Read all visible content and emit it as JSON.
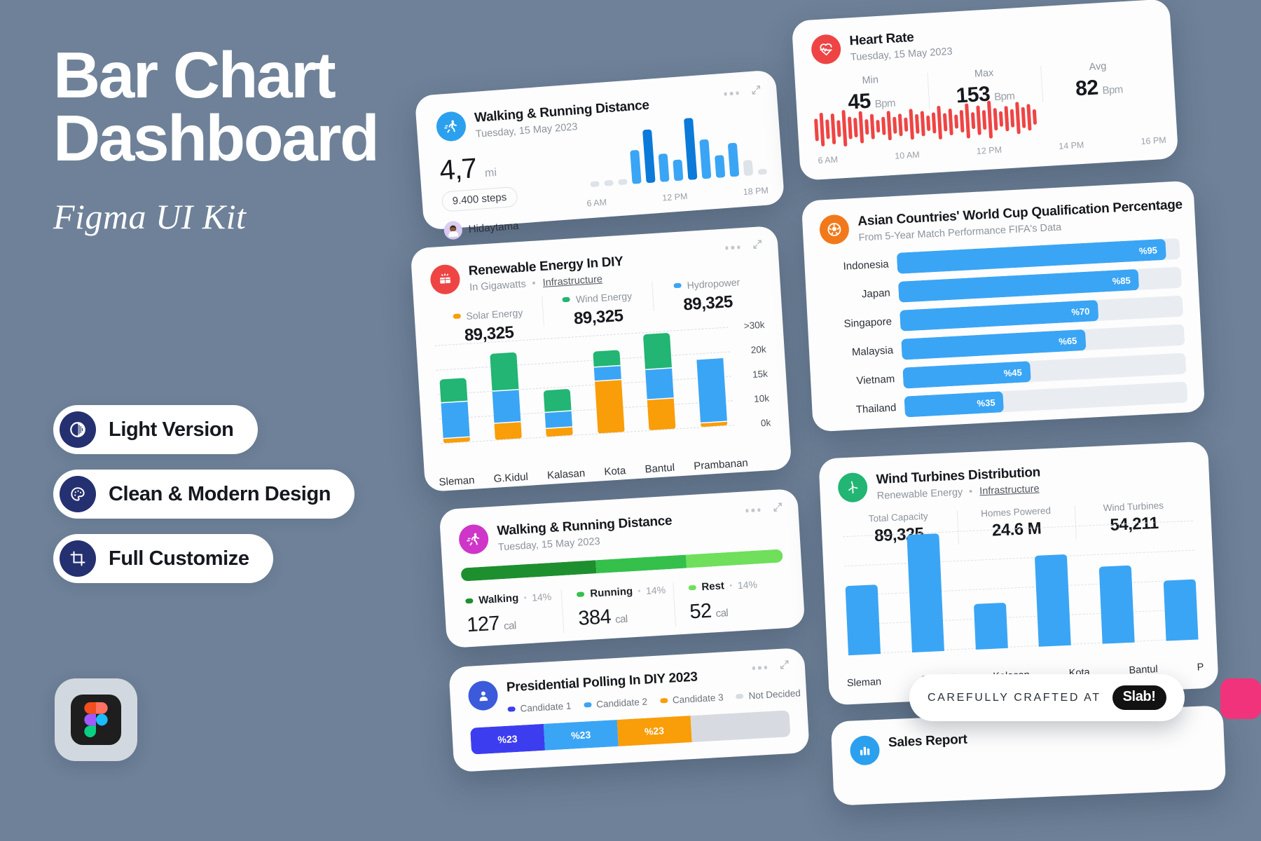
{
  "hero": {
    "title": "Bar Chart\nDashboard",
    "subtitle": "Figma UI Kit",
    "features": [
      {
        "label": "Light Version",
        "icon": "contrast-icon"
      },
      {
        "label": "Clean & Modern Design",
        "icon": "palette-icon"
      },
      {
        "label": "Full Customize",
        "icon": "crop-icon"
      }
    ],
    "brand_badge": "figma-logo-icon"
  },
  "colors": {
    "background": "#6e8198",
    "card": "#fdfdfd",
    "accent_blue": "#3aa5f5",
    "deep_blue": "#0b7ad8",
    "orange": "#f99d09",
    "green": "#22b573",
    "red": "#ef4444",
    "magenta": "#cf35c8",
    "navy": "#243070",
    "pink": "#f0337a"
  },
  "walking_card": {
    "title": "Walking & Running Distance",
    "date": "Tuesday, 15 May 2023",
    "icon": "running-icon",
    "value": "4,7",
    "unit": "mi",
    "steps_pill": "9.400 steps",
    "author": "Hidaytama",
    "avatar": "user-avatar",
    "tools": {
      "more": "more-options-icon",
      "expand": "expand-icon"
    },
    "chart_data": {
      "type": "bar",
      "title": "Walking & Running Distance",
      "categories": [
        "",
        "",
        "",
        "6 AM",
        "",
        "",
        "",
        "12 PM",
        "",
        "",
        "18 PM",
        "",
        ""
      ],
      "values": [
        8,
        8,
        8,
        48,
        76,
        40,
        30,
        88,
        56,
        32,
        48,
        22,
        8
      ],
      "ticklabels": [
        "6 AM",
        "12 PM",
        "18 PM"
      ],
      "grid": false,
      "ylabel": "",
      "xlabel": "",
      "colors": [
        "#dee3ea",
        "#dee3ea",
        "#dee3ea",
        "#3aa5f5",
        "#0b7ad8",
        "#3aa5f5",
        "#3aa5f5",
        "#0b7ad8",
        "#3aa5f5",
        "#3aa5f5",
        "#3aa5f5",
        "#dee3ea",
        "#dee3ea"
      ]
    }
  },
  "renewable_card": {
    "title": "Renewable Energy In DIY",
    "sub_left": "In Gigawatts",
    "sub_link": "Infrastructure",
    "icon": "solar-panel-icon",
    "tools": {
      "more": "more-options-icon",
      "expand": "expand-icon"
    },
    "legend": [
      {
        "name": "Solar Energy",
        "value": "89,325",
        "color": "#f99d09"
      },
      {
        "name": "Wind Energy",
        "value": "89,325",
        "color": "#22b573"
      },
      {
        "name": "Hydropower",
        "value": "89,325",
        "color": "#3aa5f5"
      }
    ],
    "chart_data": {
      "type": "bar",
      "stacked": true,
      "title": "Renewable Energy In DIY",
      "categories": [
        "Sleman",
        "G.Kidul",
        "Kalasan",
        "Kota",
        "Bantul",
        "Prambanan"
      ],
      "series": [
        {
          "name": "Solar Energy",
          "color": "#f99d09",
          "values": [
            1.0,
            4.0,
            2.0,
            13.0,
            7.5,
            0.8
          ]
        },
        {
          "name": "Wind Energy",
          "color": "#22b573",
          "values": [
            6.0,
            9.5,
            5.5,
            4.0,
            9.0,
            0.0
          ]
        },
        {
          "name": "Hydropower",
          "color": "#3aa5f5",
          "values": [
            9.0,
            8.0,
            4.0,
            3.5,
            7.5,
            16.0
          ]
        }
      ],
      "yticks": [
        ">30k",
        "20k",
        "15k",
        "10k",
        "0k"
      ],
      "ylabel": "Gigawatts",
      "xlabel": "",
      "grid": true
    }
  },
  "activity_card": {
    "title": "Walking & Running Distance",
    "date": "Tuesday, 15 May 2023",
    "icon": "running-icon",
    "tools": {
      "more": "more-options-icon",
      "expand": "expand-icon"
    },
    "chart_data": {
      "type": "bar",
      "stacked": true,
      "title": "Walking & Running Distance",
      "categories": [
        "Walking",
        "Running",
        "Rest"
      ],
      "values": [
        42,
        28,
        30
      ],
      "labels": [
        "127 cal",
        "384 cal",
        "52 cal"
      ],
      "percents": [
        "14%",
        "14%",
        "14%"
      ],
      "colors": [
        "#1e8f2e",
        "#34c04b",
        "#6fdf5c"
      ],
      "grid": false
    },
    "stats": [
      {
        "name": "Walking",
        "percent": "14%",
        "value": "127",
        "unit": "cal",
        "color": "#1e8f2e"
      },
      {
        "name": "Running",
        "percent": "14%",
        "value": "384",
        "unit": "cal",
        "color": "#34c04b"
      },
      {
        "name": "Rest",
        "percent": "14%",
        "value": "52",
        "unit": "cal",
        "color": "#6fdf5c"
      }
    ]
  },
  "polling_card": {
    "title": "Presidential Polling In DIY 2023",
    "icon": "people-icon",
    "tools": {
      "more": "more-options-icon",
      "expand": "expand-icon"
    },
    "legend": [
      {
        "name": "Candidate 1",
        "color": "#3d3df0"
      },
      {
        "name": "Candidate 2",
        "color": "#3aa5f5"
      },
      {
        "name": "Candidate 3",
        "color": "#f99d09"
      },
      {
        "name": "Not Decided",
        "color": "#d7dbe1"
      }
    ],
    "chart_data": {
      "type": "bar",
      "stacked": true,
      "title": "Presidential Polling In DIY 2023",
      "categories": [
        "Candidate 1",
        "Candidate 2",
        "Candidate 3",
        "Not Decided"
      ],
      "values": [
        23,
        23,
        23,
        31
      ],
      "labels": [
        "%23",
        "%23",
        "%23",
        ""
      ],
      "colors": [
        "#3d3df0",
        "#3aa5f5",
        "#f99d09",
        "#d7dbe1"
      ],
      "grid": false
    }
  },
  "heart_card": {
    "title": "Heart Rate",
    "date": "Tuesday, 15 May 2023",
    "icon": "heart-pulse-icon",
    "stats": [
      {
        "label": "Min",
        "value": "45",
        "unit": "Bpm"
      },
      {
        "label": "Max",
        "value": "153",
        "unit": "Bpm"
      },
      {
        "label": "Avg",
        "value": "82",
        "unit": "Bpm"
      }
    ],
    "chart_data": {
      "type": "bar",
      "title": "Heart Rate",
      "categories": [
        "6 AM",
        "10 AM",
        "12 PM",
        "14 PM",
        "16 PM"
      ],
      "ticklabels": [
        "6 AM",
        "10 AM",
        "12 PM",
        "14 PM",
        "16 PM"
      ],
      "values": [
        30,
        44,
        26,
        40,
        22,
        48,
        30,
        26,
        42,
        20,
        34,
        16,
        24,
        38,
        22,
        30,
        18,
        40,
        26,
        34,
        20,
        28,
        44,
        24,
        36,
        18,
        30,
        46,
        22,
        38,
        26,
        50,
        30,
        20,
        34,
        24,
        42,
        28,
        36,
        20
      ],
      "color": "#ef4444",
      "grid": false,
      "ylabel": "Bpm"
    }
  },
  "worldcup_card": {
    "title": "Asian Countries' World Cup Qualification Percentage",
    "subtitle": "From 5-Year Match Performance FIFA's Data",
    "icon": "soccer-ball-icon",
    "chart_data": {
      "type": "bar",
      "orientation": "horizontal",
      "title": "Asian Countries' World Cup Qualification Percentage",
      "subtitle": "From 5-Year Match Performance FIFA's Data",
      "categories": [
        "Indonesia",
        "Japan",
        "Singapore",
        "Malaysia",
        "Vietnam",
        "Thailand"
      ],
      "values": [
        95,
        85,
        70,
        65,
        45,
        35
      ],
      "labels": [
        "%95",
        "%85",
        "%70",
        "%65",
        "%45",
        "%35"
      ],
      "color": "#3aa5f5",
      "track_color": "#e9edf2",
      "xlim": [
        0,
        100
      ],
      "grid": false
    }
  },
  "turbine_card": {
    "title": "Wind Turbines Distribution",
    "sub_left": "Renewable Energy",
    "sub_link": "Infrastructure",
    "icon": "wind-turbine-icon",
    "stats": [
      {
        "label": "Total Capacity",
        "value": "89,325"
      },
      {
        "label": "Homes Powered",
        "value": "24.6 M"
      },
      {
        "label": "Wind Turbines",
        "value": "54,211"
      }
    ],
    "chart_data": {
      "type": "bar",
      "title": "Wind Turbines Distribution",
      "categories": [
        "Sleman",
        "G.Kidul",
        "Kalasan",
        "Kota",
        "Bantul",
        "P"
      ],
      "values": [
        58,
        98,
        38,
        76,
        64,
        50
      ],
      "color": "#3aa5f5",
      "grid": true,
      "ylabel": "",
      "xlabel": ""
    }
  },
  "sales_card": {
    "title": "Sales Report",
    "icon": "chart-icon"
  },
  "footer": {
    "crafted_text": "CAREFULLY CRAFTED AT",
    "brand": "Slab!"
  }
}
